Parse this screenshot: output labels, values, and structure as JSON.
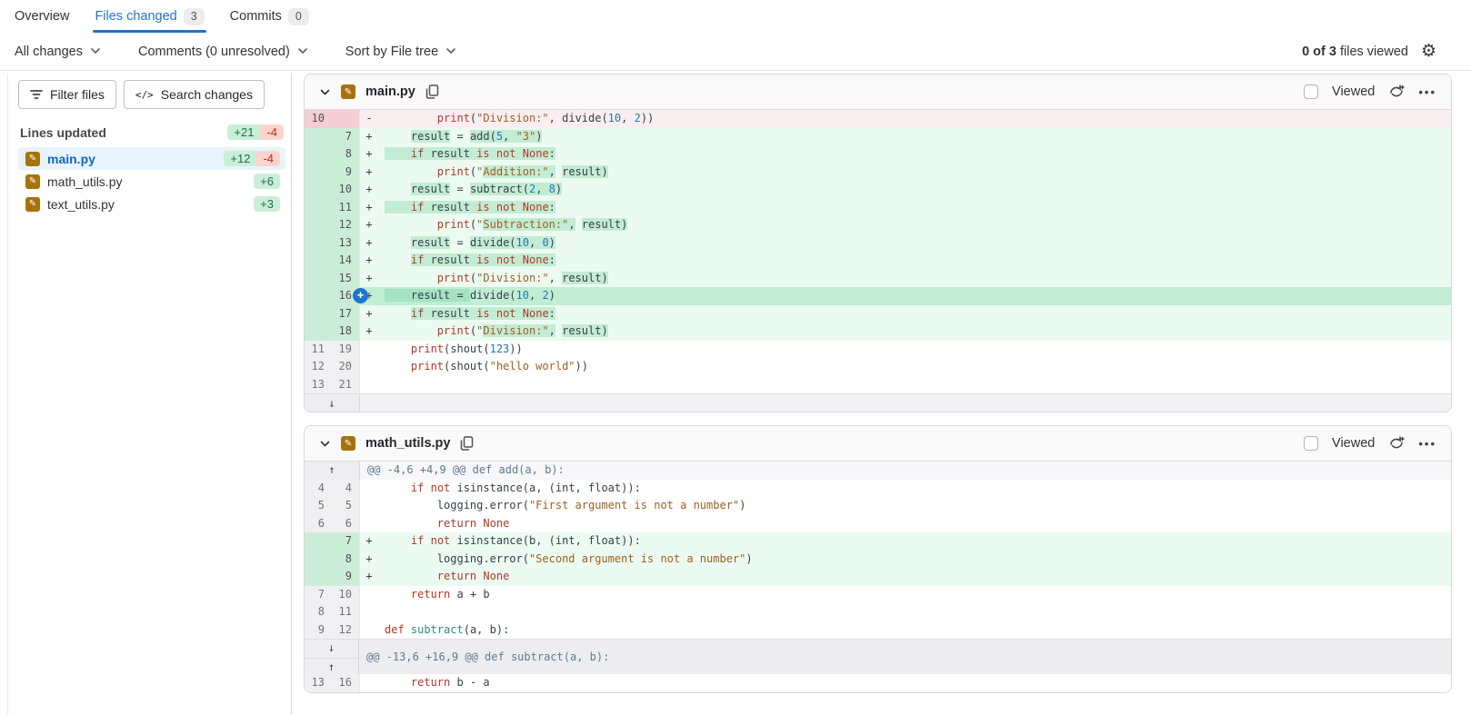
{
  "tabs": [
    {
      "label": "Overview",
      "badge": null
    },
    {
      "label": "Files changed",
      "badge": "3"
    },
    {
      "label": "Commits",
      "badge": "0"
    }
  ],
  "toolbar": {
    "dropdowns": [
      {
        "label": "All changes"
      },
      {
        "label": "Comments (0 unresolved)"
      },
      {
        "label": "Sort by File tree"
      }
    ],
    "viewed_bold": "0 of 3",
    "viewed_rest": " files viewed"
  },
  "sidebar": {
    "filter_button": "Filter files",
    "search_button": "Search changes",
    "search_icon": "</>",
    "lines_updated_label": "Lines updated",
    "total_added": "+21",
    "total_removed": "-4",
    "files": [
      {
        "name": "main.py",
        "added": "+12",
        "removed": "-4",
        "selected": true
      },
      {
        "name": "math_utils.py",
        "added": "+6",
        "removed": null,
        "selected": false
      },
      {
        "name": "text_utils.py",
        "added": "+3",
        "removed": null,
        "selected": false
      }
    ]
  },
  "colors": {
    "accent_blue": "#1f75cb",
    "added_bg": "#ecfbf1",
    "added_word_bg": "#c3ecd4",
    "removed_bg": "#fbeef0",
    "file_icon_modified": "#a6730b",
    "keyword": "#b0392a",
    "string": "#9e5e20",
    "number": "#2478b4"
  },
  "diff": {
    "files": [
      {
        "name": "main.py",
        "viewed_label": "Viewed",
        "rows": [
          {
            "type": "rem",
            "old": "10",
            "new": "",
            "sign": "-",
            "code": [
              [
                "        ",
                "p"
              ],
              [
                "print",
                "k"
              ],
              [
                "(",
                "p"
              ],
              [
                "\"Division:\"",
                "s"
              ],
              [
                ", divide(",
                "p"
              ],
              [
                "10",
                "n"
              ],
              [
                ", ",
                "p"
              ],
              [
                "2",
                "n"
              ],
              [
                "))",
                "p"
              ]
            ]
          },
          {
            "type": "add",
            "old": "",
            "new": "7",
            "sign": "+",
            "code": [
              [
                "    ",
                "p"
              ],
              [
                "result",
                "p",
                1
              ],
              [
                " = ",
                "p"
              ],
              [
                "add(",
                "p",
                1
              ],
              [
                "5",
                "n",
                1
              ],
              [
                ", ",
                "p",
                1
              ],
              [
                "\"3\"",
                "s",
                1
              ],
              [
                ")",
                "p",
                1
              ]
            ]
          },
          {
            "type": "add",
            "old": "",
            "new": "8",
            "sign": "+",
            "code": [
              [
                "    ",
                "p",
                1
              ],
              [
                "if",
                "k",
                1
              ],
              [
                " result ",
                "p",
                1
              ],
              [
                "is",
                "k",
                1
              ],
              [
                " ",
                "p",
                1
              ],
              [
                "not",
                "k",
                1
              ],
              [
                " ",
                "p",
                1
              ],
              [
                "None",
                "k",
                1
              ],
              [
                ":",
                "p",
                1
              ]
            ]
          },
          {
            "type": "add",
            "old": "",
            "new": "9",
            "sign": "+",
            "code": [
              [
                "        ",
                "p"
              ],
              [
                "print",
                "k"
              ],
              [
                "(",
                "p"
              ],
              [
                "\"",
                "s"
              ],
              [
                "Addition:\"",
                "s",
                1
              ],
              [
                ",",
                "p",
                1
              ],
              [
                " ",
                "p"
              ],
              [
                "result)",
                "p",
                1
              ]
            ]
          },
          {
            "type": "add",
            "old": "",
            "new": "10",
            "sign": "+",
            "code": [
              [
                "    ",
                "p"
              ],
              [
                "result",
                "p",
                1
              ],
              [
                " = ",
                "p"
              ],
              [
                "subtract(",
                "p",
                1
              ],
              [
                "2",
                "n",
                1
              ],
              [
                ", ",
                "p",
                1
              ],
              [
                "8",
                "n",
                1
              ],
              [
                ")",
                "p",
                1
              ]
            ]
          },
          {
            "type": "add",
            "old": "",
            "new": "11",
            "sign": "+",
            "code": [
              [
                "    ",
                "p",
                1
              ],
              [
                "if",
                "k",
                1
              ],
              [
                " result ",
                "p",
                1
              ],
              [
                "is",
                "k",
                1
              ],
              [
                " ",
                "p",
                1
              ],
              [
                "not",
                "k",
                1
              ],
              [
                " ",
                "p",
                1
              ],
              [
                "None",
                "k",
                1
              ],
              [
                ":",
                "p",
                1
              ]
            ]
          },
          {
            "type": "add",
            "old": "",
            "new": "12",
            "sign": "+",
            "code": [
              [
                "        ",
                "p"
              ],
              [
                "print",
                "k"
              ],
              [
                "(",
                "p"
              ],
              [
                "\"",
                "s"
              ],
              [
                "Subtraction:\"",
                "s",
                1
              ],
              [
                ",",
                "p",
                1
              ],
              [
                " ",
                "p"
              ],
              [
                "result)",
                "p",
                1
              ]
            ]
          },
          {
            "type": "add",
            "old": "",
            "new": "13",
            "sign": "+",
            "code": [
              [
                "    ",
                "p"
              ],
              [
                "result",
                "p",
                1
              ],
              [
                " = ",
                "p"
              ],
              [
                "divide(",
                "p",
                1
              ],
              [
                "10",
                "n",
                1
              ],
              [
                ", ",
                "p",
                1
              ],
              [
                "0",
                "n",
                1
              ],
              [
                ")",
                "p",
                1
              ]
            ]
          },
          {
            "type": "add",
            "old": "",
            "new": "14",
            "sign": "+",
            "code": [
              [
                "    ",
                "p"
              ],
              [
                "if",
                "k",
                1
              ],
              [
                " result ",
                "p",
                1
              ],
              [
                "is",
                "k",
                1
              ],
              [
                " ",
                "p",
                1
              ],
              [
                "not",
                "k",
                1
              ],
              [
                " ",
                "p",
                1
              ],
              [
                "None",
                "k",
                1
              ],
              [
                ":",
                "p",
                1
              ]
            ]
          },
          {
            "type": "add",
            "old": "",
            "new": "15",
            "sign": "+",
            "code": [
              [
                "        ",
                "p"
              ],
              [
                "print",
                "k"
              ],
              [
                "(",
                "p"
              ],
              [
                "\"Division:\"",
                "s"
              ],
              [
                ",",
                "p"
              ],
              [
                " ",
                "p"
              ],
              [
                "result)",
                "p",
                1
              ]
            ]
          },
          {
            "type": "add",
            "old": "",
            "new": "16",
            "sign": "+",
            "hover": true,
            "comment": true,
            "code": [
              [
                "    ",
                "p",
                1
              ],
              [
                "result",
                "p",
                1
              ],
              [
                " = ",
                "p",
                1
              ],
              [
                "divide(",
                "p"
              ],
              [
                "10",
                "n"
              ],
              [
                ", ",
                "p"
              ],
              [
                "2",
                "n"
              ],
              [
                ")",
                "p"
              ]
            ]
          },
          {
            "type": "add",
            "old": "",
            "new": "17",
            "sign": "+",
            "code": [
              [
                "    ",
                "p"
              ],
              [
                "if",
                "k",
                1
              ],
              [
                " result ",
                "p",
                1
              ],
              [
                "is",
                "k",
                1
              ],
              [
                " ",
                "p",
                1
              ],
              [
                "not",
                "k",
                1
              ],
              [
                " ",
                "p",
                1
              ],
              [
                "None",
                "k",
                1
              ],
              [
                ":",
                "p",
                1
              ]
            ]
          },
          {
            "type": "add",
            "old": "",
            "new": "18",
            "sign": "+",
            "code": [
              [
                "        ",
                "p"
              ],
              [
                "print",
                "k"
              ],
              [
                "(",
                "p"
              ],
              [
                "\"",
                "s"
              ],
              [
                "Division:\"",
                "s",
                1
              ],
              [
                ",",
                "p",
                1
              ],
              [
                " ",
                "p"
              ],
              [
                "result)",
                "p",
                1
              ]
            ]
          },
          {
            "type": "ctx",
            "old": "11",
            "new": "19",
            "sign": "",
            "code": [
              [
                "    ",
                "p"
              ],
              [
                "print",
                "k"
              ],
              [
                "(shout(",
                "p"
              ],
              [
                "123",
                "n"
              ],
              [
                "))",
                "p"
              ]
            ]
          },
          {
            "type": "ctx",
            "old": "12",
            "new": "20",
            "sign": "",
            "code": [
              [
                "    ",
                "p"
              ],
              [
                "print",
                "k"
              ],
              [
                "(shout(",
                "p"
              ],
              [
                "\"hello world\"",
                "s"
              ],
              [
                "))",
                "p"
              ]
            ]
          },
          {
            "type": "ctx",
            "old": "13",
            "new": "21",
            "sign": "",
            "code": []
          },
          {
            "type": "expand",
            "arrow": "down"
          }
        ]
      },
      {
        "name": "math_utils.py",
        "viewed_label": "Viewed",
        "rows": [
          {
            "type": "hunk",
            "arrow": "up",
            "text": "@@ -4,6 +4,9 @@ def add(a, b):"
          },
          {
            "type": "ctx",
            "old": "4",
            "new": "4",
            "sign": "",
            "code": [
              [
                "    ",
                "p"
              ],
              [
                "if",
                "k"
              ],
              [
                " ",
                "p"
              ],
              [
                "not",
                "k"
              ],
              [
                " isinstance(a, (int, float)):",
                "p"
              ]
            ]
          },
          {
            "type": "ctx",
            "old": "5",
            "new": "5",
            "sign": "",
            "code": [
              [
                "        logging.error(",
                "p"
              ],
              [
                "\"First argument is not a number\"",
                "s"
              ],
              [
                ")",
                "p"
              ]
            ]
          },
          {
            "type": "ctx",
            "old": "6",
            "new": "6",
            "sign": "",
            "code": [
              [
                "        ",
                "p"
              ],
              [
                "return",
                "k"
              ],
              [
                " ",
                "p"
              ],
              [
                "None",
                "k"
              ]
            ]
          },
          {
            "type": "add",
            "old": "",
            "new": "7",
            "sign": "+",
            "code": [
              [
                "    ",
                "p"
              ],
              [
                "if",
                "k"
              ],
              [
                " ",
                "p"
              ],
              [
                "not",
                "k"
              ],
              [
                " isinstance(b, (int, float)):",
                "p"
              ]
            ]
          },
          {
            "type": "add",
            "old": "",
            "new": "8",
            "sign": "+",
            "code": [
              [
                "        logging.error(",
                "p"
              ],
              [
                "\"Second argument is not a number\"",
                "s"
              ],
              [
                ")",
                "p"
              ]
            ]
          },
          {
            "type": "add",
            "old": "",
            "new": "9",
            "sign": "+",
            "code": [
              [
                "        ",
                "p"
              ],
              [
                "return",
                "k"
              ],
              [
                " ",
                "p"
              ],
              [
                "None",
                "k"
              ]
            ]
          },
          {
            "type": "ctx",
            "old": "7",
            "new": "10",
            "sign": "",
            "code": [
              [
                "    ",
                "p"
              ],
              [
                "return",
                "k"
              ],
              [
                " a + b",
                "p"
              ]
            ]
          },
          {
            "type": "ctx",
            "old": "8",
            "new": "11",
            "sign": "",
            "code": []
          },
          {
            "type": "ctx",
            "old": "9",
            "new": "12",
            "sign": "",
            "code": [
              [
                "def",
                "k"
              ],
              [
                " ",
                "p"
              ],
              [
                "subtract",
                "f"
              ],
              [
                "(a, b):",
                "p"
              ]
            ]
          },
          {
            "type": "exp2",
            "text": "@@ -13,6 +16,9 @@ def subtract(a, b):"
          },
          {
            "type": "ctx",
            "old": "13",
            "new": "16",
            "sign": "",
            "code": [
              [
                "    ",
                "p"
              ],
              [
                "return",
                "k"
              ],
              [
                " b - a",
                "p"
              ]
            ]
          }
        ]
      }
    ]
  },
  "glyphs": {
    "expand_down": "↓",
    "expand_up": "↑",
    "pencil": "✎",
    "plus": "+",
    "kebab": "•••",
    "gear": "⚙"
  }
}
